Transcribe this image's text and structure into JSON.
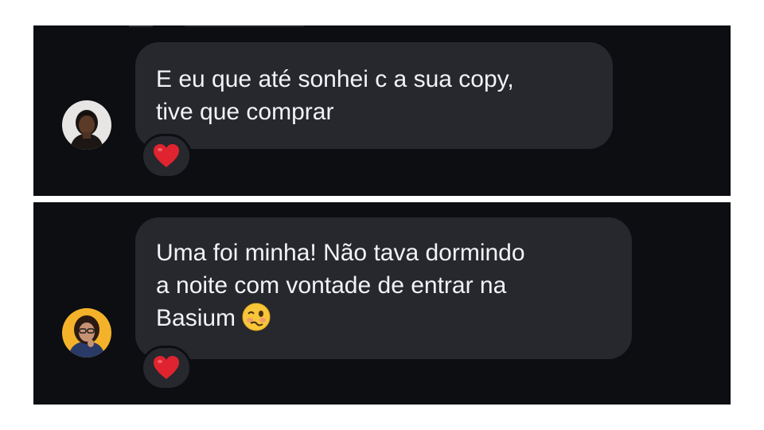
{
  "messages": [
    {
      "lines": [
        "E eu que até sonhei c a sua copy,",
        "tive que comprar"
      ],
      "reaction": "red-heart",
      "avatar": "user-avatar-1"
    },
    {
      "lines": [
        "Uma foi minha! Não tava dormindo",
        "a noite com vontade de entrar na",
        "Basium"
      ],
      "trailing_emoji": "woozy-face",
      "reaction": "red-heart",
      "avatar": "user-avatar-2"
    }
  ],
  "colors": {
    "panel_bg": "#0c0e12",
    "bubble_bg": "#26282e",
    "text": "#f2f3f5",
    "heart": "#e0242f"
  }
}
